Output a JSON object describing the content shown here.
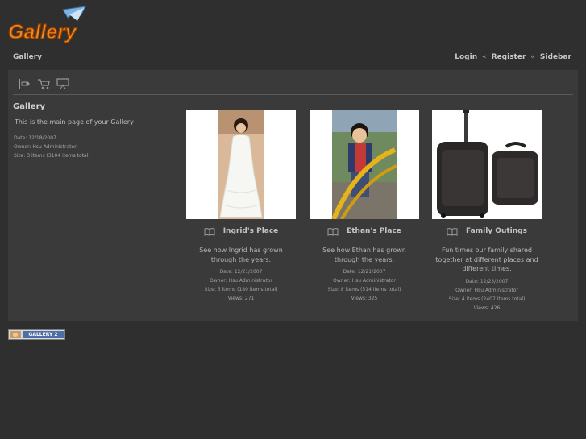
{
  "logo": {
    "text": "Gallery"
  },
  "header": {
    "breadcrumb": "Gallery",
    "links": [
      {
        "label": "Login"
      },
      {
        "label": "Register"
      },
      {
        "label": "Sidebar"
      }
    ],
    "separator": "«"
  },
  "toolbar": {
    "icons": [
      "slideshow-icon",
      "cart-icon",
      "presentation-icon"
    ]
  },
  "sidebar": {
    "title": "Gallery",
    "description": "This is the main page of your Gallery",
    "date": "Date: 12/18/2007",
    "owner": "Owner: Hsu Administrator",
    "size": "Size: 3 items (3104 items total)"
  },
  "albums": [
    {
      "title": "Ingrid's Place",
      "description": "See how Ingrid has grown through the years.",
      "date": "Date: 12/21/2007",
      "owner": "Owner: Hsu Administrator",
      "size": "Size: 5 items (180 items total)",
      "views": "Views: 271"
    },
    {
      "title": "Ethan's Place",
      "description": "See how Ethan has grown through the years.",
      "date": "Date: 12/21/2007",
      "owner": "Owner: Hsu Administrator",
      "size": "Size: 8 items (514 items total)",
      "views": "Views: 325"
    },
    {
      "title": "Family Outings",
      "description": "Fun times our family shared together at different places and different times.",
      "date": "Date: 12/23/2007",
      "owner": "Owner: Hsu Administrator",
      "size": "Size: 4 items (2407 items total)",
      "views": "Views: 426"
    }
  ],
  "footer": {
    "badge_text": "GALLERY 2"
  }
}
